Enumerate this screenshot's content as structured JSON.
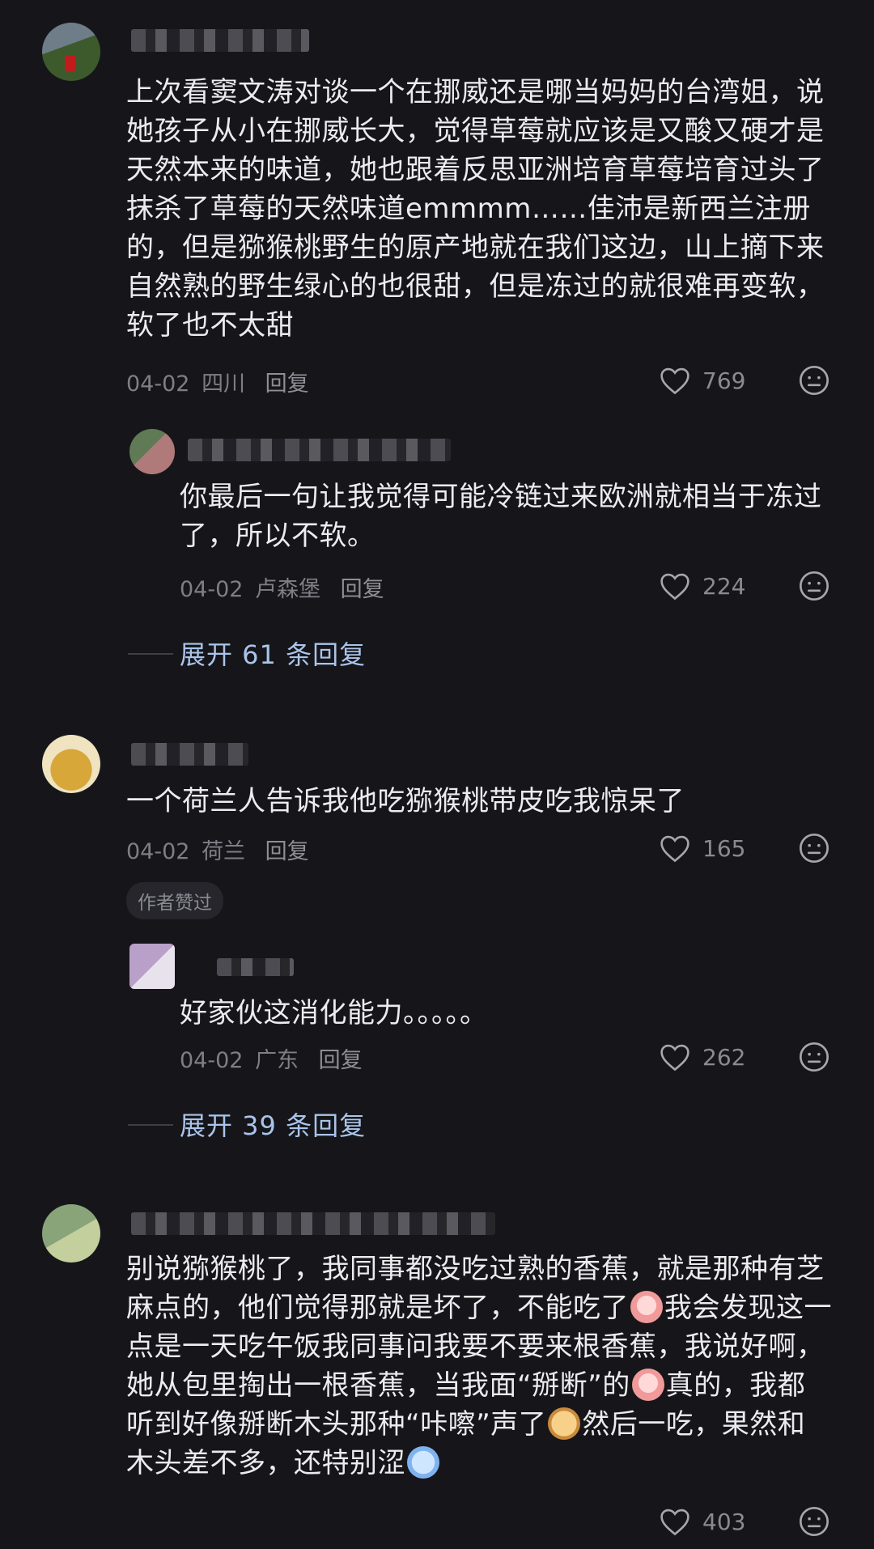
{
  "comments": [
    {
      "text": "上次看窦文涛对谈一个在挪威还是哪当妈妈的台湾姐，说她孩子从小在挪威长大，觉得草莓就应该是又酸又硬才是天然本来的味道，她也跟着反思亚洲培育草莓培育过头了抹杀了草莓的天然味道emmmm……佳沛是新西兰注册的，但是猕猴桃野生的原产地就在我们这边，山上摘下来自然熟的野生绿心的也很甜，但是冻过的就很难再变软，软了也不太甜",
      "date": "04-02",
      "location": "四川",
      "reply_label": "回复",
      "likes": "769"
    },
    {
      "text": "你最后一句让我觉得可能冷链过来欧洲就相当于冻过了，所以不软。",
      "date": "04-02",
      "location": "卢森堡",
      "reply_label": "回复",
      "likes": "224"
    },
    {
      "text": "一个荷兰人告诉我他吃猕猴桃带皮吃我惊呆了",
      "date": "04-02",
      "location": "荷兰",
      "reply_label": "回复",
      "likes": "165",
      "badge": "作者赞过"
    },
    {
      "text": "好家伙这消化能力。。。。。",
      "date": "04-02",
      "location": "广东",
      "reply_label": "回复",
      "likes": "262"
    },
    {
      "text_parts": [
        "别说猕猴桃了，我同事都没吃过熟的香蕉，就是那种有芝麻点的，他们觉得那就是坏了，不能吃了",
        "我会发现这一点是一天吃午饭我同事问我要不要来根香蕉，我说好啊，她从包里掏出一根香蕉，当我面“掰断”的",
        "真的，我都听到好像掰断木头那种“咔嚓”声了",
        "然后一吃，果然和木头差不多，还特别涩"
      ],
      "likes": "403"
    }
  ],
  "expand_1": "展开 61 条回复",
  "expand_2": "展开 39 条回复"
}
